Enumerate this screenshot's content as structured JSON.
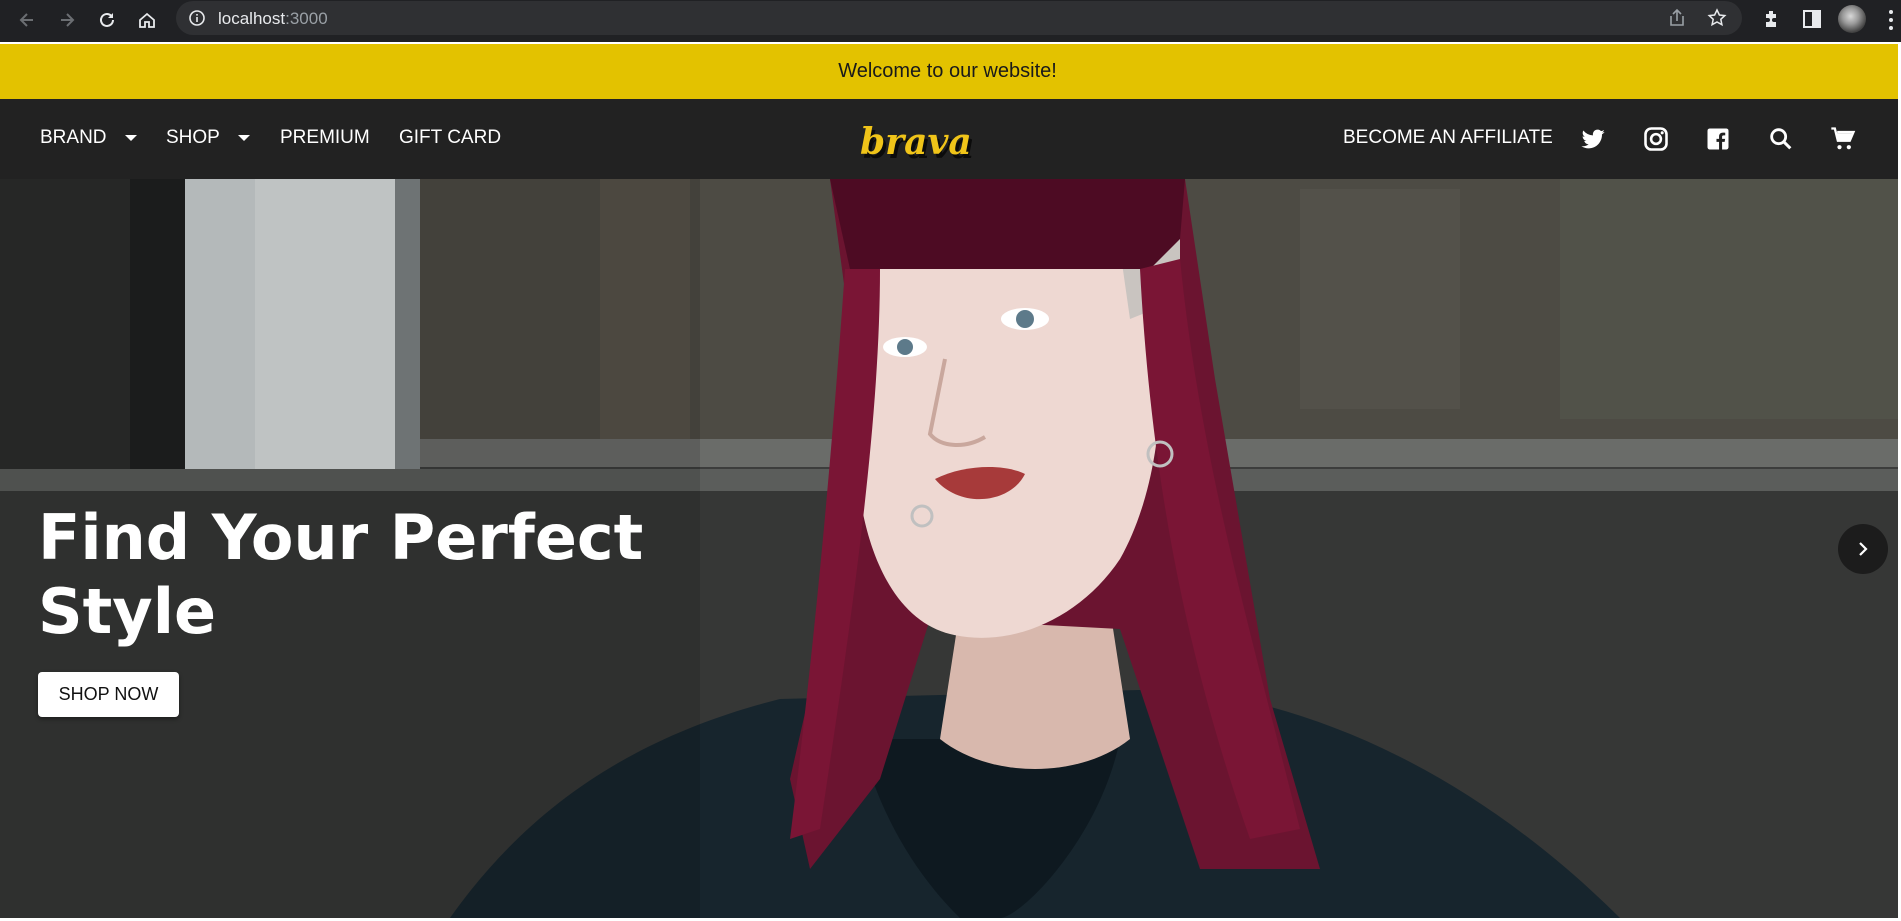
{
  "browser": {
    "url_host": "localhost",
    "url_port": ":3000",
    "icons": [
      "back-icon",
      "forward-icon",
      "reload-icon",
      "home-icon",
      "info-icon",
      "share-icon",
      "star-icon",
      "extensions-icon",
      "sidepanel-icon",
      "profile-avatar",
      "menu-icon"
    ]
  },
  "announcement": {
    "text": "Welcome to our website!"
  },
  "header": {
    "nav": [
      {
        "label": "BRAND",
        "has_dropdown": true
      },
      {
        "label": "SHOP",
        "has_dropdown": true
      },
      {
        "label": "PREMIUM",
        "has_dropdown": false
      },
      {
        "label": "GIFT CARD",
        "has_dropdown": false
      }
    ],
    "logo_text": "brava",
    "affiliate_label": "BECOME AN AFFILIATE",
    "icons": [
      "twitter-icon",
      "instagram-icon",
      "facebook-icon",
      "search-icon",
      "cart-icon"
    ]
  },
  "hero": {
    "title_line1": "Find Your Perfect",
    "title_line2": "Style",
    "cta_label": "SHOP NOW",
    "next_icon": "chevron-right-icon"
  },
  "colors": {
    "chrome_bg": "#202124",
    "announce_bg": "#e3c200",
    "header_bg": "#222222",
    "logo": "#f0c419",
    "hair": "#7a1535"
  }
}
